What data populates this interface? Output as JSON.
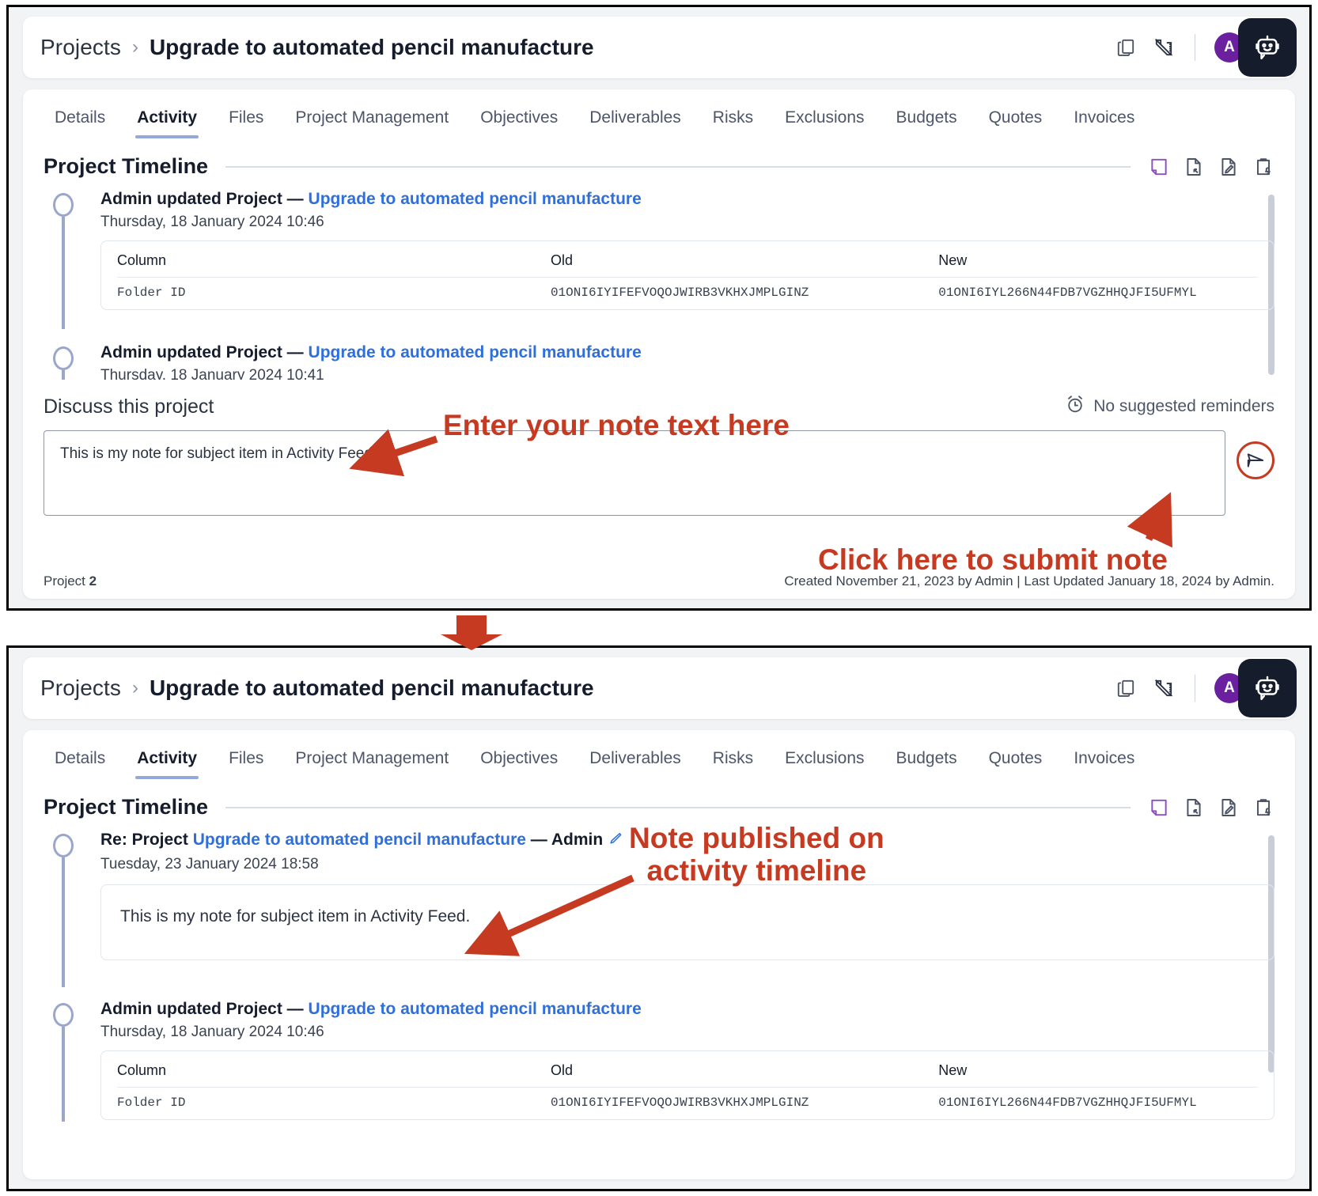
{
  "colors": {
    "accent_link": "#2f6fdb",
    "annotation_red": "#c63a22",
    "avatar_purple": "#6b219f",
    "timeline_purple": "#8b4fc0",
    "tab_underline": "#94a9d8",
    "bot_button_bg": "#151c2c"
  },
  "header": {
    "breadcrumb_root": "Projects",
    "breadcrumb_separator": "›",
    "title": "Upgrade to automated pencil manufacture",
    "avatar_initial": "A",
    "icons": [
      "copy-icon",
      "ruler-set-square-icon",
      "chevron-down-icon",
      "robot-assistant-icon"
    ]
  },
  "tabs": [
    {
      "label": "Details",
      "active": false
    },
    {
      "label": "Activity",
      "active": true
    },
    {
      "label": "Files",
      "active": false
    },
    {
      "label": "Project Management",
      "active": false
    },
    {
      "label": "Objectives",
      "active": false
    },
    {
      "label": "Deliverables",
      "active": false
    },
    {
      "label": "Risks",
      "active": false
    },
    {
      "label": "Exclusions",
      "active": false
    },
    {
      "label": "Budgets",
      "active": false
    },
    {
      "label": "Quotes",
      "active": false
    },
    {
      "label": "Invoices",
      "active": false
    }
  ],
  "timeline": {
    "title": "Project Timeline",
    "action_icons": [
      "sticky-note-icon",
      "file-link-icon",
      "file-edit-icon",
      "clipboard-reminder-icon"
    ]
  },
  "change_table": {
    "headers": [
      "Column",
      "Old",
      "New"
    ],
    "rows": [
      {
        "column": "Folder ID",
        "old": "01ONI6IYIFEFVOQOJWIRB3VKHXJMPLGINZ",
        "new": "01ONI6IYL266N44FDB7VGZHHQJFI5UFMYL"
      }
    ]
  },
  "top_panel": {
    "events": [
      {
        "prefix": "Admin updated Project — ",
        "link": "Upgrade to automated pencil manufacture",
        "suffix": "",
        "date": "Thursday, 18 January 2024 10:46",
        "has_table": true
      },
      {
        "prefix": "Admin updated Project — ",
        "link": "Upgrade to automated pencil manufacture",
        "suffix": "",
        "date": "Thursday, 18 January 2024 10:41",
        "has_table": false
      }
    ],
    "discuss": {
      "label": "Discuss this project",
      "reminders_text": "No suggested reminders",
      "reminders_icon": "alarm-clock-icon",
      "note_value": "This is my note for subject item in Activity Feed.",
      "note_placeholder": "Discuss this project",
      "send_icon": "send-paper-plane-icon"
    },
    "footer": {
      "left_label": "Project",
      "left_value": "2",
      "right": "Created November 21, 2023 by Admin | Last Updated January 18, 2024 by Admin."
    }
  },
  "bottom_panel": {
    "events": [
      {
        "prefix": "Re: Project ",
        "link": "Upgrade to automated pencil manufacture",
        "suffix": " — Admin",
        "date": "Tuesday, 23 January 2024 18:58",
        "note_body": "This is my note for subject item in Activity Feed.",
        "edit_icon": "pencil-edit-icon"
      },
      {
        "prefix": "Admin updated Project — ",
        "link": "Upgrade to automated pencil manufacture",
        "suffix": "",
        "date": "Thursday, 18 January 2024 10:46",
        "has_table": true
      }
    ]
  },
  "annotations": {
    "enter_note": "Enter your note text here",
    "click_submit": "Click here to submit note",
    "note_published": "Note published on\nactivity timeline"
  }
}
